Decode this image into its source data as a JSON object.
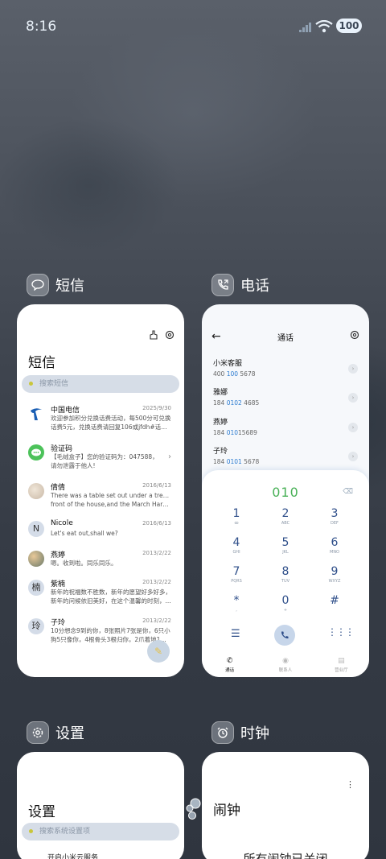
{
  "status_bar": {
    "time": "8:16",
    "battery": "100"
  },
  "apps": {
    "sms": {
      "label": "短信",
      "title": "短信",
      "search_placeholder": "搜索短信",
      "messages": [
        {
          "avatar": "",
          "name": "中国电信",
          "date": "2025/9/30",
          "line1": "欢迎参加积分兑换话费活动，每500分可兑换",
          "line2": "话费5元，兑换话费请回复106或jfdh#话费..."
        },
        {
          "avatar": "",
          "name": "验证码",
          "date": "",
          "line1": "【毛绒盒子】您的验证码为：047588，",
          "line2": "请勿泄露于他人!"
        },
        {
          "avatar": "",
          "name": "倩倩",
          "date": "2016/6/13",
          "line1": "There was a table set out under a tree in",
          "line2": "front of the house,and the March Hare an..."
        },
        {
          "avatar": "N",
          "name": "Nicole",
          "date": "2016/6/13",
          "line1": "Let's eat out,shall we?",
          "line2": ""
        },
        {
          "avatar": "",
          "name": "燕婷",
          "date": "2013/2/22",
          "line1": "嗯。收到啦。同乐同乐。",
          "line2": ""
        },
        {
          "avatar": "楠",
          "name": "紫楠",
          "date": "2013/2/22",
          "line1": "新年的祝福数不胜数，新年的愿望好多好多，",
          "line2": "新年的问候依旧美好，在这个温馨的时刻，..."
        },
        {
          "avatar": "玲",
          "name": "子玲",
          "date": "2013/2/22",
          "line1": "10分想念9到的你，8张照片7张是你，6只小",
          "line2": "狗5只像你，4根骨头3根归你，2爪着地1定..."
        }
      ]
    },
    "phone": {
      "label": "电话",
      "title": "通话",
      "contacts": [
        {
          "name": "小米客服",
          "pre": "400 ",
          "hl": "100",
          "post": " 5678"
        },
        {
          "name": "雅娜",
          "pre": "184 ",
          "hl": "0102",
          "post": " 4685"
        },
        {
          "name": "燕婷",
          "pre": "184 ",
          "hl": "010",
          "post": "15689"
        },
        {
          "name": "子玲",
          "pre": "184 ",
          "hl": "0101",
          "post": " 5678"
        }
      ],
      "dialed": "010",
      "keys": [
        {
          "d": "1",
          "l": "ꝏ"
        },
        {
          "d": "2",
          "l": "ABC"
        },
        {
          "d": "3",
          "l": "DEF"
        },
        {
          "d": "4",
          "l": "GHI"
        },
        {
          "d": "5",
          "l": "JKL"
        },
        {
          "d": "6",
          "l": "MNO"
        },
        {
          "d": "7",
          "l": "PQRS"
        },
        {
          "d": "8",
          "l": "TUV"
        },
        {
          "d": "9",
          "l": "WXYZ"
        },
        {
          "d": "*",
          "l": ","
        },
        {
          "d": "0",
          "l": "+"
        },
        {
          "d": "#",
          "l": ""
        }
      ],
      "nav": [
        "通话",
        "联系人",
        "营业厅"
      ]
    },
    "settings": {
      "label": "设置",
      "title": "设置",
      "search_placeholder": "搜索系统设置项",
      "first_item": "开启小米云服务"
    },
    "clock": {
      "label": "时钟",
      "title": "闹钟",
      "empty_text": "所有闹钟已关闭"
    }
  }
}
